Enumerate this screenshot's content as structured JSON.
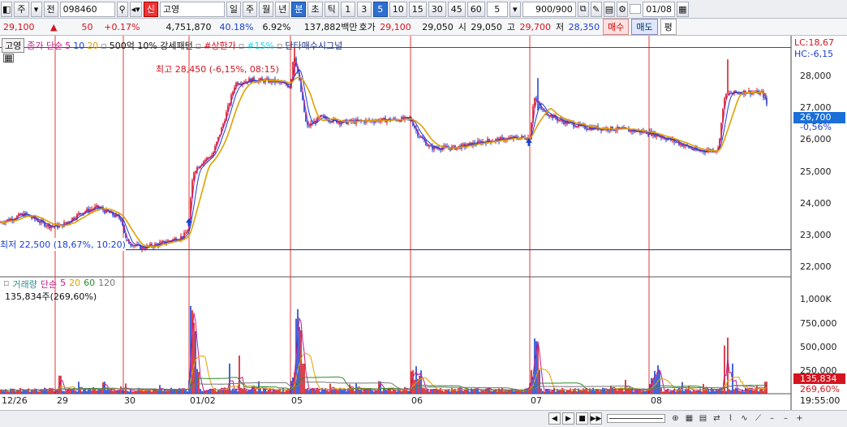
{
  "toolbar": {
    "stock_type": "주",
    "prev": "전",
    "code": "098460",
    "name_badge": "신",
    "name": "고영",
    "periods": [
      "일",
      "주",
      "월",
      "년",
      "분",
      "초",
      "틱"
    ],
    "active_period": "분",
    "minutes": [
      "1",
      "3",
      "5",
      "10",
      "15",
      "30",
      "45",
      "60"
    ],
    "active_minute": "5",
    "custom_min": "5",
    "count": "900/900",
    "date": "01/08"
  },
  "info": {
    "price": "29,100",
    "change": "50",
    "change_pct": "+0.17%",
    "volume": "4,751,870",
    "vol_ratio": "40.18%",
    "turnover": "6.92%",
    "amount": "137,882백만",
    "quote_label": "호가",
    "quote": "29,100",
    "quote2": "29,050",
    "open_label": "시",
    "open": "29,050",
    "high_label": "고",
    "high": "29,700",
    "low_label": "저",
    "low": "28,350",
    "buy": "매수",
    "sell": "매도",
    "avg": "평"
  },
  "legend": {
    "name": "고영",
    "ma_label": "종가 단순",
    "ma_periods": [
      "5",
      "10",
      "20"
    ],
    "item1": "500억 10% 강세패턴",
    "item2": "#상한가",
    "item3": "#15%",
    "item4": "단타매수시그널"
  },
  "vol_legend": {
    "title": "거래량",
    "ma_label": "단순",
    "periods": [
      "5",
      "20",
      "60",
      "120"
    ],
    "info": "135,834주(269,60%)"
  },
  "right": {
    "lc": "LC:18,67",
    "hc": "HC:-6,15",
    "price_ticks": [
      "28,000",
      "27,000",
      "26,000",
      "25,000",
      "24,000",
      "23,000",
      "22,000"
    ],
    "current": "26,700",
    "current_chg": "-0,56%",
    "vol_ticks": [
      "1,000K",
      "750,000",
      "500,000",
      "250,000"
    ],
    "cur_vol": "135,834",
    "cur_vol_pct": "269,60%",
    "time": "19:55:00"
  },
  "annotations": {
    "high": "최고 28,450 (-6,15%, 08:15)",
    "low": "최저 22,500 (18,67%, 10:20)"
  },
  "xlabels": [
    "12/26",
    "29",
    "30",
    "01/02",
    "05",
    "06",
    "07",
    "08"
  ],
  "colors": {
    "up": "#d4141e",
    "down": "#1a3fd1",
    "ma5": "#c2188a",
    "ma10": "#1a3fd1",
    "ma20": "#e0a000",
    "ma60": "#2e8b2e"
  },
  "chart_data": {
    "type": "line",
    "title": "",
    "price_range": [
      21800,
      28700
    ],
    "series": [
      {
        "name": "종가",
        "x": [
          "12/26",
          "29",
          "30",
          "01/02",
          "01/02",
          "05",
          "05",
          "06",
          "06",
          "07",
          "07",
          "08",
          "08",
          "08"
        ],
        "values": [
          23300,
          23700,
          22600,
          22900,
          27400,
          28450,
          26300,
          26300,
          25500,
          25800,
          26700,
          26000,
          25400,
          26700
        ]
      }
    ],
    "volume_range": [
      0,
      1100000
    ]
  }
}
